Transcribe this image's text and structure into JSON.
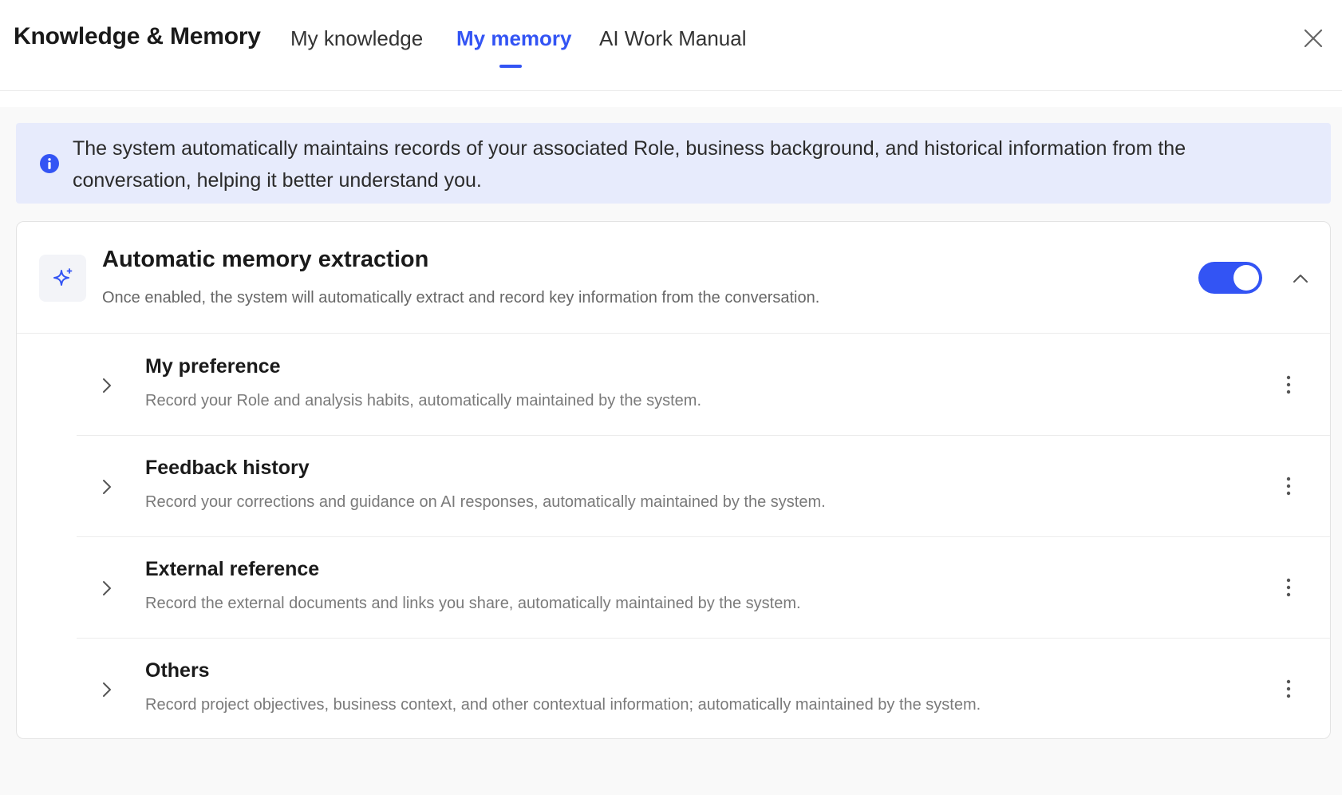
{
  "header": {
    "title": "Knowledge & Memory",
    "tabs": [
      {
        "label": "My knowledge",
        "active": false
      },
      {
        "label": "My memory",
        "active": true
      },
      {
        "label": "AI Work Manual",
        "active": false
      }
    ],
    "close_icon": "close-icon"
  },
  "banner": {
    "icon": "info-icon",
    "text": "The system automatically maintains records of your associated Role, business background, and historical information from the conversation, helping it better understand you."
  },
  "memory_card": {
    "icon": "sparkle-icon",
    "title": "Automatic memory extraction",
    "description": "Once enabled, the system will automatically extract and record key information from the conversation.",
    "enabled": true,
    "expanded": true,
    "items": [
      {
        "title": "My preference",
        "description": "Record your Role and analysis habits, automatically maintained by the system."
      },
      {
        "title": "Feedback history",
        "description": "Record your corrections and guidance on AI responses, automatically maintained by the system."
      },
      {
        "title": "External reference",
        "description": "Record the external documents and links you share, automatically maintained by the system."
      },
      {
        "title": "Others",
        "description": "Record project objectives, business context, and other contextual information; automatically maintained by the system."
      }
    ]
  },
  "colors": {
    "accent": "#3354f4",
    "banner_bg": "#e7ebfc",
    "page_bg": "#f9f9f9"
  }
}
